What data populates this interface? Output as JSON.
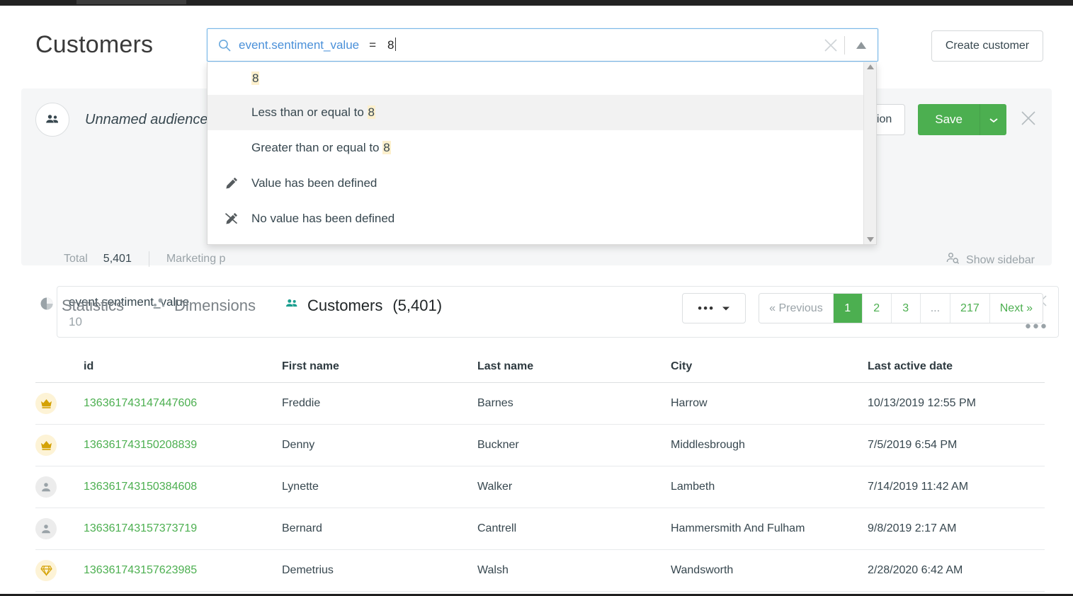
{
  "header": {
    "title": "Customers",
    "create_button": "Create customer"
  },
  "search": {
    "field": "event.sentiment_value",
    "operator": "=",
    "value": "8",
    "icons": {
      "search": "search-icon",
      "clear": "close-icon",
      "collapse": "triangle-up-icon"
    }
  },
  "dropdown": {
    "items": [
      {
        "label": "",
        "highlight": "8",
        "icon": "",
        "active": false
      },
      {
        "label": "Less than or equal to ",
        "highlight": "8",
        "icon": "",
        "active": true
      },
      {
        "label": "Greater than or equal to ",
        "highlight": "8",
        "icon": "",
        "active": false
      },
      {
        "label": "Value has been defined",
        "highlight": "",
        "icon": "pencil-icon",
        "active": false
      },
      {
        "label": "No value has been defined",
        "highlight": "",
        "icon": "pencil-slash-icon",
        "active": false
      }
    ]
  },
  "audience": {
    "name": "Unnamed audience",
    "avatar_icon": "people-icon",
    "action_button": "e action",
    "save_button": "Save",
    "save_caret_icon": "chevron-down-icon",
    "close_icon": "close-icon",
    "stats": {
      "total_label": "Total",
      "total_value": "5,401",
      "second_label": "Marketing p"
    },
    "show_sidebar": {
      "label": "Show sidebar",
      "icon": "person-search-icon"
    },
    "filter": {
      "field": "event.sentiment_value",
      "value": "10",
      "close_icon": "close-icon",
      "more_icon": "ellipsis-icon"
    }
  },
  "tabs": [
    {
      "label": "Statistics",
      "icon": "pie-chart-icon",
      "active": false,
      "count": ""
    },
    {
      "label": "Dimensions",
      "icon": "dimensions-icon",
      "active": false,
      "count": ""
    },
    {
      "label": "Customers",
      "icon": "people-icon",
      "active": true,
      "count": "(5,401)"
    }
  ],
  "pagination": {
    "dots_label": "•••",
    "pages": [
      {
        "label": "« Previous",
        "state": "muted"
      },
      {
        "label": "1",
        "state": "current"
      },
      {
        "label": "2",
        "state": "link"
      },
      {
        "label": "3",
        "state": "link"
      },
      {
        "label": "...",
        "state": "muted"
      },
      {
        "label": "217",
        "state": "link"
      },
      {
        "label": "Next »",
        "state": "link"
      }
    ]
  },
  "table": {
    "columns": [
      "id",
      "First name",
      "Last name",
      "City",
      "Last active date"
    ],
    "rows": [
      {
        "icon": "crown-icon",
        "icon_style": "gold",
        "id": "136361743147447606",
        "first_name": "Freddie",
        "last_name": "Barnes",
        "city": "Harrow",
        "last_active": "10/13/2019 12:55 PM"
      },
      {
        "icon": "crown-icon",
        "icon_style": "gold",
        "id": "136361743150208839",
        "first_name": "Denny",
        "last_name": "Buckner",
        "city": "Middlesbrough",
        "last_active": "7/5/2019 6:54 PM"
      },
      {
        "icon": "person-icon",
        "icon_style": "gray",
        "id": "136361743150384608",
        "first_name": "Lynette",
        "last_name": "Walker",
        "city": "Lambeth",
        "last_active": "7/14/2019 11:42 AM"
      },
      {
        "icon": "person-icon",
        "icon_style": "gray",
        "id": "136361743157373719",
        "first_name": "Bernard",
        "last_name": "Cantrell",
        "city": "Hammersmith And Fulham",
        "last_active": "9/8/2019 2:17 AM"
      },
      {
        "icon": "diamond-icon",
        "icon_style": "gold",
        "id": "136361743157623985",
        "first_name": "Demetrius",
        "last_name": "Walsh",
        "city": "Wandsworth",
        "last_active": "2/28/2020 6:42 AM"
      }
    ]
  },
  "colors": {
    "accent_green": "#4caf50",
    "link_blue": "#4a90d9",
    "highlight_yellow": "#fdf0cd",
    "text_dark": "#37474f",
    "text_muted": "#9aa3a8"
  }
}
